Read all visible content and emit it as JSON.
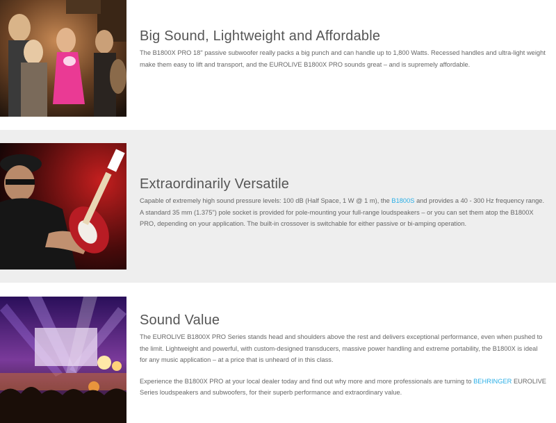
{
  "sections": [
    {
      "image_subject": "party-crowd-photo",
      "title": "Big Sound, Lightweight and Affordable",
      "paragraphs": [
        {
          "text": "The B1800X PRO 18\" passive subwoofer really packs a big punch and can handle up to 1,800 Watts. Recessed handles and ultra-light weight make them easy to lift and transport, and the EUROLIVE B1800X PRO sounds great – and is supremely affordable."
        }
      ]
    },
    {
      "image_subject": "guitarist-photo",
      "title": "Extraordinarily Versatile",
      "paragraphs": [
        {
          "before": "Capable of extremely high sound pressure levels: 100 dB (Half Space, 1 W @ 1 m), the ",
          "link": "B1800S",
          "after": " and provides a 40 - 300 Hz frequency range. A standard 35 mm (1.375\") pole socket is provided for pole-mounting your full-range loudspeakers – or you can set them atop the B1800X PRO, depending on your application. The built-in crossover is switchable for either passive or bi-amping operation."
        }
      ]
    },
    {
      "image_subject": "concert-stage-photo",
      "title": "Sound Value",
      "paragraphs": [
        {
          "text": "The EUROLIVE B1800X PRO Series stands head and shoulders above the rest and delivers exceptional performance, even when pushed to the limit. Lightweight and powerful, with custom-designed transducers, massive power handling and extreme portability, the B1800X is ideal for any music application – at a price that is unheard of in this class."
        },
        {
          "before": "Experience the B1800X PRO at your local dealer today and find out why more and more professionals are turning to ",
          "link": "BEHRINGER",
          "after": " EUROLIVE Series loudspeakers and subwoofers, for their superb performance and extraordinary value."
        }
      ]
    }
  ],
  "colors": {
    "link": "#29aee6",
    "gray_band": "#eeeeee",
    "text": "#666666"
  }
}
